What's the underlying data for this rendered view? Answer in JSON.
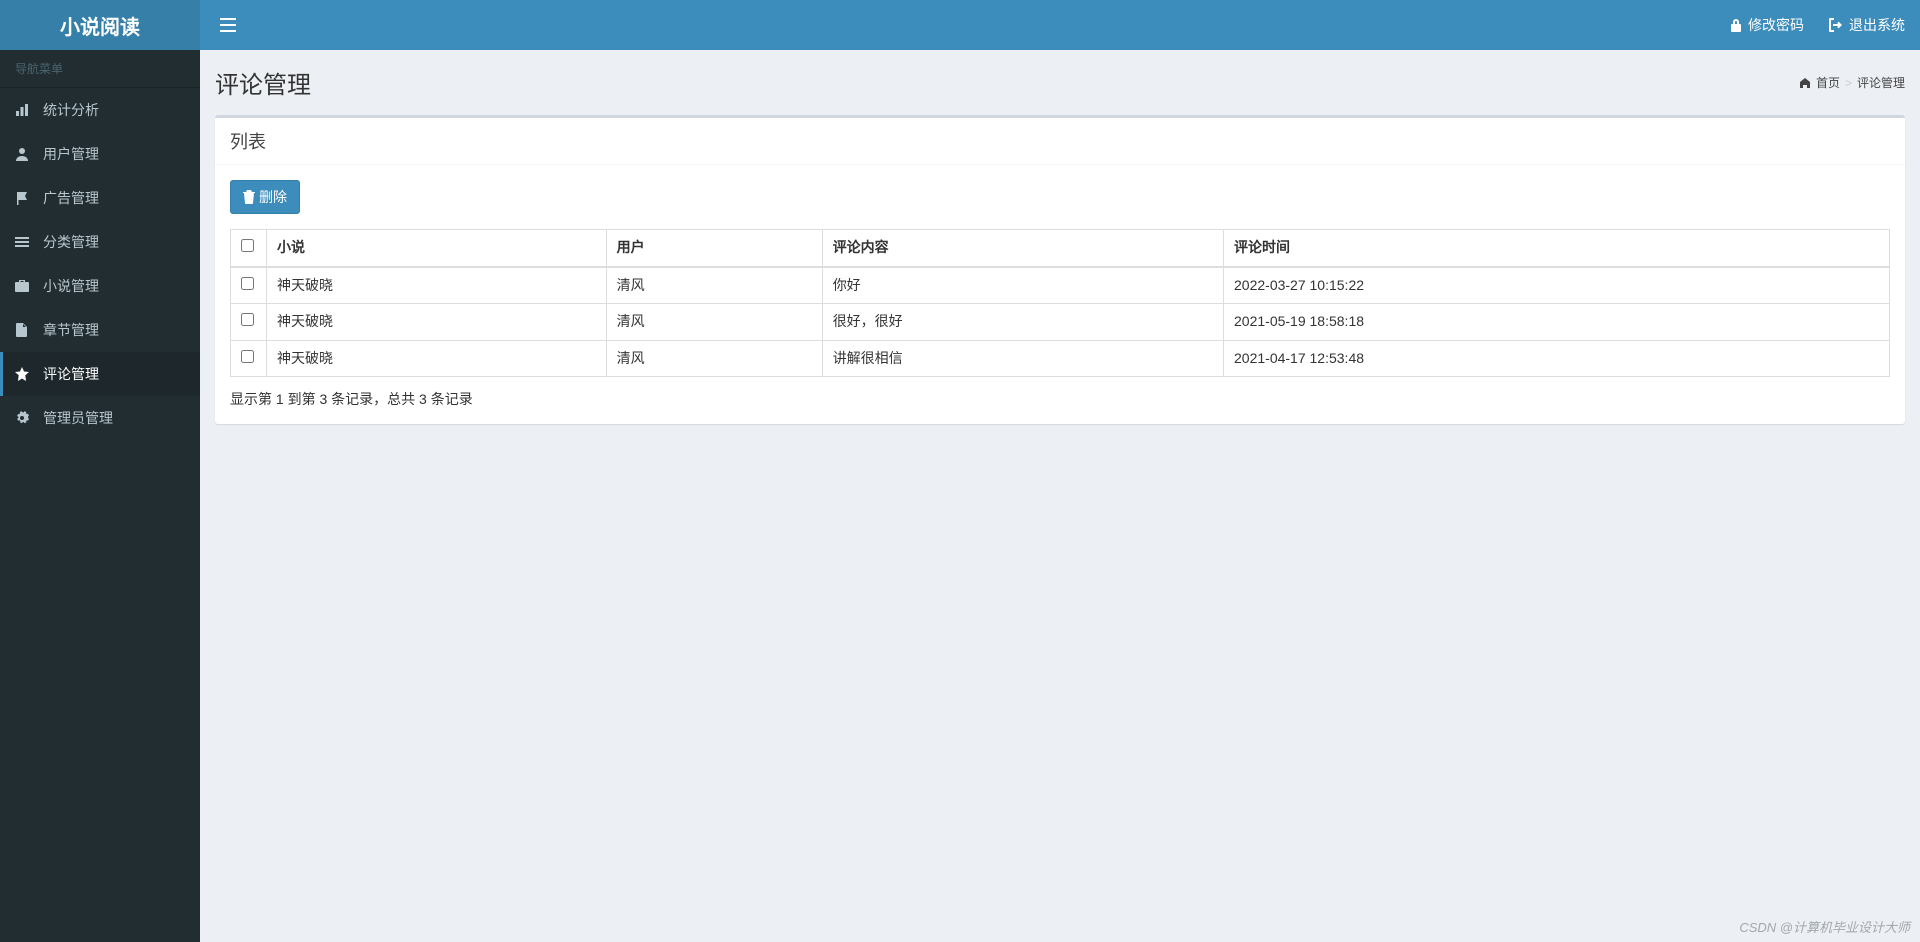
{
  "app": {
    "name": "小说阅读"
  },
  "topbar": {
    "change_password": "修改密码",
    "logout": "退出系统"
  },
  "sidebar": {
    "header": "导航菜单",
    "items": [
      {
        "icon": "bar-chart-icon",
        "label": "统计分析"
      },
      {
        "icon": "user-icon",
        "label": "用户管理"
      },
      {
        "icon": "flag-icon",
        "label": "广告管理"
      },
      {
        "icon": "list-icon",
        "label": "分类管理"
      },
      {
        "icon": "briefcase-icon",
        "label": "小说管理"
      },
      {
        "icon": "file-icon",
        "label": "章节管理"
      },
      {
        "icon": "star-icon",
        "label": "评论管理"
      },
      {
        "icon": "gear-icon",
        "label": "管理员管理"
      }
    ],
    "active_index": 6
  },
  "page": {
    "title": "评论管理",
    "breadcrumb": {
      "home": "首页",
      "current": "评论管理"
    }
  },
  "list": {
    "panel_title": "列表",
    "delete_label": "删除",
    "columns": [
      "小说",
      "用户",
      "评论内容",
      "评论时间"
    ],
    "rows": [
      {
        "novel": "神天破晓",
        "user": "清风",
        "content": "你好",
        "time": "2022-03-27 10:15:22"
      },
      {
        "novel": "神天破晓",
        "user": "清风",
        "content": "很好，很好",
        "time": "2021-05-19 18:58:18"
      },
      {
        "novel": "神天破晓",
        "user": "清风",
        "content": "讲解很相信",
        "time": "2021-04-17 12:53:48"
      }
    ],
    "info": "显示第 1 到第 3 条记录，总共 3 条记录"
  },
  "watermark": "CSDN @计算机毕业设计大师"
}
